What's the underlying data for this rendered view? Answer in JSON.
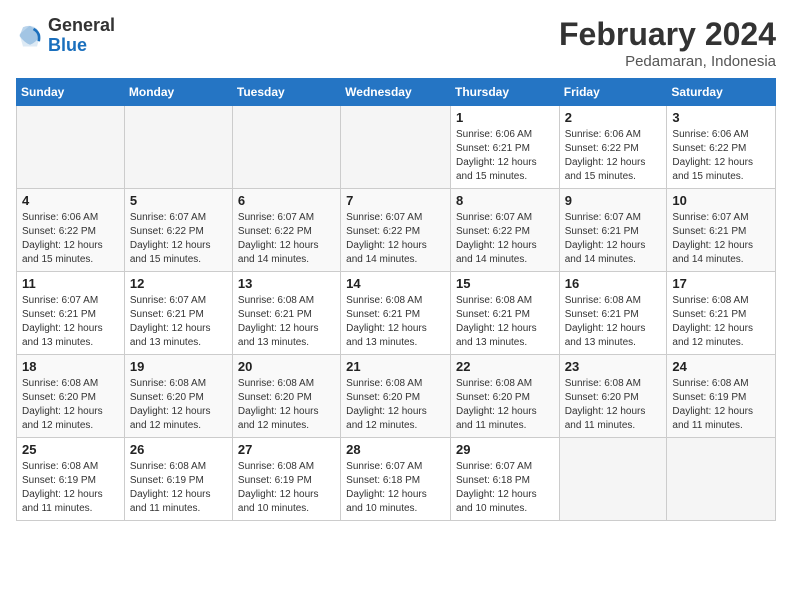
{
  "logo": {
    "general": "General",
    "blue": "Blue"
  },
  "header": {
    "month": "February 2024",
    "location": "Pedamaran, Indonesia"
  },
  "weekdays": [
    "Sunday",
    "Monday",
    "Tuesday",
    "Wednesday",
    "Thursday",
    "Friday",
    "Saturday"
  ],
  "weeks": [
    [
      {
        "day": "",
        "info": ""
      },
      {
        "day": "",
        "info": ""
      },
      {
        "day": "",
        "info": ""
      },
      {
        "day": "",
        "info": ""
      },
      {
        "day": "1",
        "info": "Sunrise: 6:06 AM\nSunset: 6:21 PM\nDaylight: 12 hours and 15 minutes."
      },
      {
        "day": "2",
        "info": "Sunrise: 6:06 AM\nSunset: 6:22 PM\nDaylight: 12 hours and 15 minutes."
      },
      {
        "day": "3",
        "info": "Sunrise: 6:06 AM\nSunset: 6:22 PM\nDaylight: 12 hours and 15 minutes."
      }
    ],
    [
      {
        "day": "4",
        "info": "Sunrise: 6:06 AM\nSunset: 6:22 PM\nDaylight: 12 hours and 15 minutes."
      },
      {
        "day": "5",
        "info": "Sunrise: 6:07 AM\nSunset: 6:22 PM\nDaylight: 12 hours and 15 minutes."
      },
      {
        "day": "6",
        "info": "Sunrise: 6:07 AM\nSunset: 6:22 PM\nDaylight: 12 hours and 14 minutes."
      },
      {
        "day": "7",
        "info": "Sunrise: 6:07 AM\nSunset: 6:22 PM\nDaylight: 12 hours and 14 minutes."
      },
      {
        "day": "8",
        "info": "Sunrise: 6:07 AM\nSunset: 6:22 PM\nDaylight: 12 hours and 14 minutes."
      },
      {
        "day": "9",
        "info": "Sunrise: 6:07 AM\nSunset: 6:21 PM\nDaylight: 12 hours and 14 minutes."
      },
      {
        "day": "10",
        "info": "Sunrise: 6:07 AM\nSunset: 6:21 PM\nDaylight: 12 hours and 14 minutes."
      }
    ],
    [
      {
        "day": "11",
        "info": "Sunrise: 6:07 AM\nSunset: 6:21 PM\nDaylight: 12 hours and 13 minutes."
      },
      {
        "day": "12",
        "info": "Sunrise: 6:07 AM\nSunset: 6:21 PM\nDaylight: 12 hours and 13 minutes."
      },
      {
        "day": "13",
        "info": "Sunrise: 6:08 AM\nSunset: 6:21 PM\nDaylight: 12 hours and 13 minutes."
      },
      {
        "day": "14",
        "info": "Sunrise: 6:08 AM\nSunset: 6:21 PM\nDaylight: 12 hours and 13 minutes."
      },
      {
        "day": "15",
        "info": "Sunrise: 6:08 AM\nSunset: 6:21 PM\nDaylight: 12 hours and 13 minutes."
      },
      {
        "day": "16",
        "info": "Sunrise: 6:08 AM\nSunset: 6:21 PM\nDaylight: 12 hours and 13 minutes."
      },
      {
        "day": "17",
        "info": "Sunrise: 6:08 AM\nSunset: 6:21 PM\nDaylight: 12 hours and 12 minutes."
      }
    ],
    [
      {
        "day": "18",
        "info": "Sunrise: 6:08 AM\nSunset: 6:20 PM\nDaylight: 12 hours and 12 minutes."
      },
      {
        "day": "19",
        "info": "Sunrise: 6:08 AM\nSunset: 6:20 PM\nDaylight: 12 hours and 12 minutes."
      },
      {
        "day": "20",
        "info": "Sunrise: 6:08 AM\nSunset: 6:20 PM\nDaylight: 12 hours and 12 minutes."
      },
      {
        "day": "21",
        "info": "Sunrise: 6:08 AM\nSunset: 6:20 PM\nDaylight: 12 hours and 12 minutes."
      },
      {
        "day": "22",
        "info": "Sunrise: 6:08 AM\nSunset: 6:20 PM\nDaylight: 12 hours and 11 minutes."
      },
      {
        "day": "23",
        "info": "Sunrise: 6:08 AM\nSunset: 6:20 PM\nDaylight: 12 hours and 11 minutes."
      },
      {
        "day": "24",
        "info": "Sunrise: 6:08 AM\nSunset: 6:19 PM\nDaylight: 12 hours and 11 minutes."
      }
    ],
    [
      {
        "day": "25",
        "info": "Sunrise: 6:08 AM\nSunset: 6:19 PM\nDaylight: 12 hours and 11 minutes."
      },
      {
        "day": "26",
        "info": "Sunrise: 6:08 AM\nSunset: 6:19 PM\nDaylight: 12 hours and 11 minutes."
      },
      {
        "day": "27",
        "info": "Sunrise: 6:08 AM\nSunset: 6:19 PM\nDaylight: 12 hours and 10 minutes."
      },
      {
        "day": "28",
        "info": "Sunrise: 6:07 AM\nSunset: 6:18 PM\nDaylight: 12 hours and 10 minutes."
      },
      {
        "day": "29",
        "info": "Sunrise: 6:07 AM\nSunset: 6:18 PM\nDaylight: 12 hours and 10 minutes."
      },
      {
        "day": "",
        "info": ""
      },
      {
        "day": "",
        "info": ""
      }
    ]
  ]
}
